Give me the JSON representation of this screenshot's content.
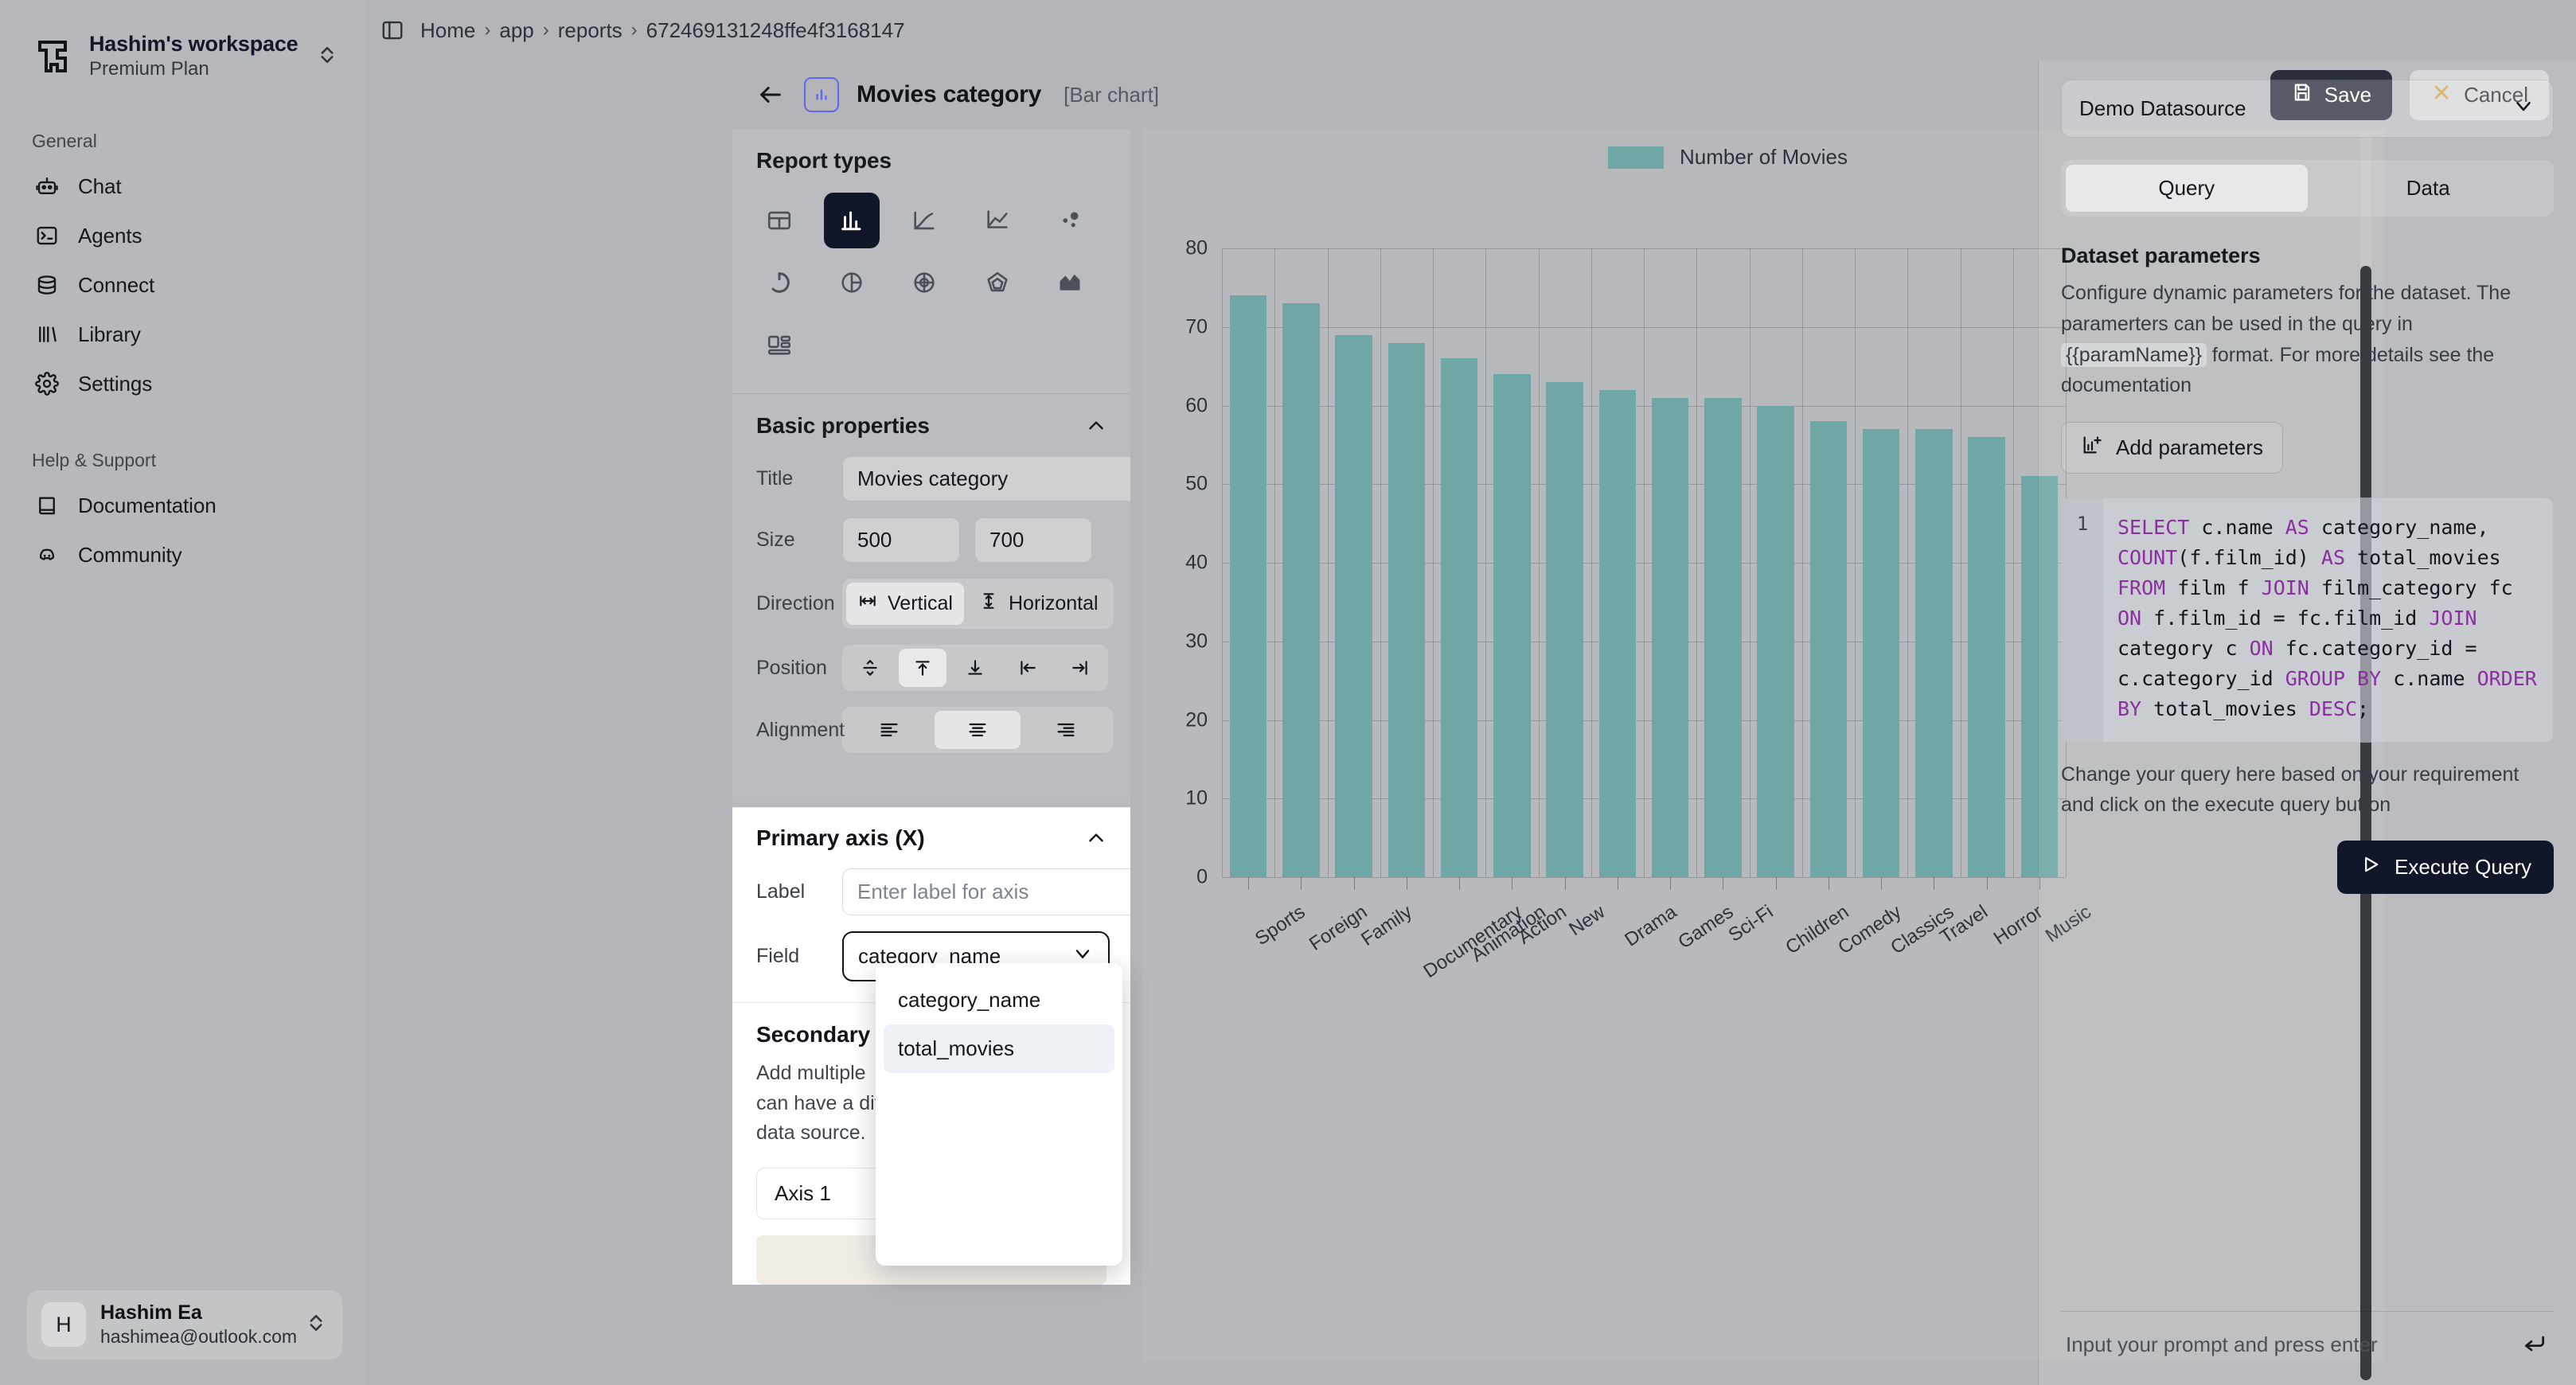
{
  "workspace": {
    "name": "Hashim's workspace",
    "plan": "Premium Plan"
  },
  "sidebar": {
    "general_label": "General",
    "help_label": "Help & Support",
    "general_items": [
      {
        "label": "Chat",
        "icon": "robot-icon"
      },
      {
        "label": "Agents",
        "icon": "terminal-icon"
      },
      {
        "label": "Connect",
        "icon": "database-icon"
      },
      {
        "label": "Library",
        "icon": "library-icon"
      },
      {
        "label": "Settings",
        "icon": "gear-icon"
      }
    ],
    "help_items": [
      {
        "label": "Documentation",
        "icon": "book-icon"
      },
      {
        "label": "Community",
        "icon": "discord-icon"
      }
    ],
    "user": {
      "initial": "H",
      "name": "Hashim Ea",
      "email": "hashimea@outlook.com"
    }
  },
  "breadcrumb": {
    "items": [
      "Home",
      "app",
      "reports",
      "672469131248ffe4f3168147"
    ],
    "separator": "›"
  },
  "editor": {
    "title": "Movies category",
    "subtitle": "[Bar chart]",
    "save_label": "Save",
    "cancel_label": "Cancel"
  },
  "report_types": {
    "title": "Report types",
    "items": [
      {
        "name": "table-chart",
        "active": false
      },
      {
        "name": "bar-chart",
        "active": true
      },
      {
        "name": "line-chart",
        "active": false
      },
      {
        "name": "combo-chart",
        "active": false
      },
      {
        "name": "scatter-chart",
        "active": false
      },
      {
        "name": "donut-chart",
        "active": false
      },
      {
        "name": "pie-chart",
        "active": false
      },
      {
        "name": "radial-chart",
        "active": false
      },
      {
        "name": "radar-chart",
        "active": false
      },
      {
        "name": "area-chart",
        "active": false
      },
      {
        "name": "card-chart",
        "active": false
      }
    ]
  },
  "basic_properties": {
    "title": "Basic properties",
    "title_label": "Title",
    "title_value": "Movies category",
    "size_label": "Size",
    "size_width": "500",
    "size_height": "700",
    "direction_label": "Direction",
    "direction_options": [
      "Vertical",
      "Horizontal"
    ],
    "direction_selected": "Vertical",
    "position_label": "Position",
    "position_icons": [
      "split-vertical-icon",
      "align-top-icon",
      "align-bottom-icon",
      "align-left-icon",
      "align-right-icon"
    ],
    "position_selected_index": 1,
    "alignment_label": "Alignment",
    "alignment_icons": [
      "align-text-left-icon",
      "align-text-center-icon",
      "align-text-right-icon"
    ],
    "alignment_selected_index": 1
  },
  "primary_axis": {
    "title": "Primary axis (X)",
    "label_label": "Label",
    "label_placeholder": "Enter label for axis",
    "label_value": "",
    "field_label": "Field",
    "field_value": "category_name",
    "dropdown_options": [
      "category_name",
      "total_movies"
    ],
    "dropdown_highlighted": "total_movies"
  },
  "secondary_axis": {
    "title": "Secondary a",
    "description": "Add multiple\ncan have a dif\ndata source.",
    "axis_chip": "Axis 1"
  },
  "chart_data": {
    "type": "bar",
    "title": "",
    "legend": [
      "Number of Movies"
    ],
    "legend_position": "top",
    "series_color": "#6fa6a6",
    "categories": [
      "Sports",
      "Foreign",
      "Family",
      "Documentary",
      "Animation",
      "Action",
      "New",
      "Drama",
      "Games",
      "Sci-Fi",
      "Children",
      "Comedy",
      "Classics",
      "Travel",
      "Horror",
      "Music"
    ],
    "values": [
      74,
      73,
      69,
      68,
      66,
      64,
      63,
      62,
      61,
      61,
      60,
      58,
      57,
      57,
      56,
      51
    ],
    "series": [
      {
        "name": "Number of Movies",
        "values": [
          74,
          73,
          69,
          68,
          66,
          64,
          63,
          62,
          61,
          61,
          60,
          58,
          57,
          57,
          56,
          51
        ]
      }
    ],
    "xlabel": "",
    "ylabel": "",
    "ylim": [
      0,
      80
    ],
    "yticks": [
      0,
      10,
      20,
      30,
      40,
      50,
      60,
      70,
      80
    ],
    "grid": true
  },
  "right_panel": {
    "datasource": "Demo Datasource",
    "tabs": [
      "Query",
      "Data"
    ],
    "active_tab": "Query",
    "dataset_parameters_title": "Dataset parameters",
    "dataset_parameters_desc_1": "Configure dynamic parameters for the dataset. The paramerters can be used in the query in ",
    "dataset_parameters_code": "{{paramName}}",
    "dataset_parameters_desc_2": " format. For more details see the documentation",
    "add_parameters_label": "Add parameters",
    "sql_line_number": "1",
    "sql_query": "SELECT c.name AS category_name, COUNT(f.film_id) AS total_movies FROM film f JOIN film_category fc ON f.film_id = fc.film_id JOIN category c ON fc.category_id = c.category_id GROUP BY c.name ORDER BY total_movies DESC;",
    "sql_keywords": [
      "SELECT",
      "AS",
      "COUNT",
      "FROM",
      "JOIN",
      "ON",
      "GROUP",
      "BY",
      "ORDER",
      "DESC"
    ],
    "query_note": "Change your query here based on your requirement and click on the execute query button",
    "execute_label": "Execute Query",
    "prompt_placeholder": "Input your prompt and press enter"
  }
}
